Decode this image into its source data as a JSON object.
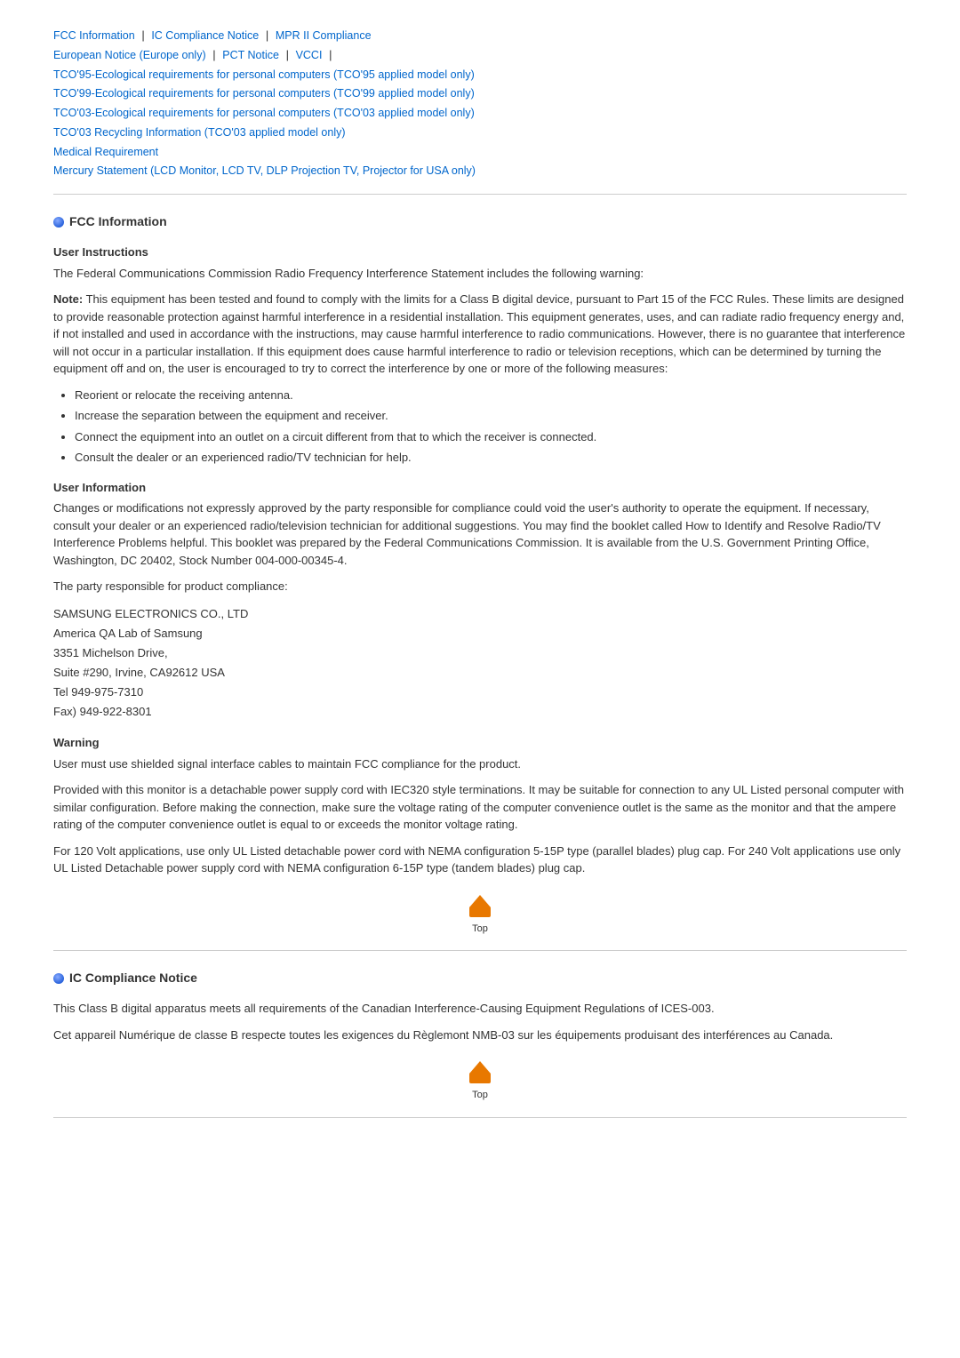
{
  "nav": {
    "line1": [
      {
        "text": "FCC Information",
        "sep": " | "
      },
      {
        "text": "IC Compliance Notice",
        "sep": " | "
      },
      {
        "text": "MPR II Compliance",
        "sep": ""
      }
    ],
    "line2": [
      {
        "text": "European Notice (Europe only)",
        "sep": " | "
      },
      {
        "text": "PCT Notice",
        "sep": " | "
      },
      {
        "text": "VCCI",
        "sep": " | "
      }
    ],
    "line3": {
      "text": "TCO'95-Ecological requirements for personal computers (TCO'95 applied model only)"
    },
    "line4": {
      "text": "TCO'99-Ecological requirements for personal computers (TCO'99 applied model only)"
    },
    "line5": {
      "text": "TCO'03-Ecological requirements for personal computers (TCO'03 applied model only)"
    },
    "line6": {
      "text": "TCO'03 Recycling Information (TCO'03 applied model only)"
    },
    "line7": {
      "text": "Medical Requirement"
    },
    "line8": {
      "text": "Mercury Statement (LCD Monitor, LCD TV, DLP Projection TV, Projector for USA only)"
    }
  },
  "fcc_section": {
    "heading": "FCC Information",
    "user_instructions": {
      "label": "User Instructions",
      "intro": "The Federal Communications Commission Radio Frequency Interference Statement includes the following warning:",
      "note_bold": "Note:",
      "note_text": " This equipment has been tested and found to comply with the limits for a Class B digital device, pursuant to Part 15 of the FCC Rules. These limits are designed to provide reasonable protection against harmful interference in a residential installation. This equipment generates, uses, and can radiate radio frequency energy and, if not installed and used in accordance with the instructions, may cause harmful interference to radio communications. However, there is no guarantee that interference will not occur in a particular installation. If this equipment does cause harmful interference to radio or television receptions, which can be determined by turning the equipment off and on, the user is encouraged to try to correct the interference by one or more of the following measures:",
      "bullets": [
        "Reorient or relocate the receiving antenna.",
        "Increase the separation between the equipment and receiver.",
        "Connect the equipment into an outlet on a circuit different from that to which the receiver is connected.",
        "Consult the dealer or an experienced radio/TV technician for help."
      ]
    },
    "user_information": {
      "label": "User Information",
      "para1": "Changes or modifications not expressly approved by the party responsible for compliance could void the user's authority to operate the equipment. If necessary, consult your dealer or an experienced radio/television technician for additional suggestions. You may find the booklet called How to Identify and Resolve Radio/TV Interference Problems helpful. This booklet was prepared by the Federal Communications Commission. It is available from the U.S. Government Printing Office, Washington, DC 20402, Stock Number 004-000-00345-4.",
      "para2": "The party responsible for product compliance:",
      "address": "SAMSUNG ELECTRONICS CO., LTD\nAmerica QA Lab of Samsung\n3351 Michelson Drive,\nSuite #290, Irvine, CA92612 USA\nTel 949-975-7310\nFax) 949-922-8301"
    },
    "warning": {
      "label": "Warning",
      "para1": "User must use shielded signal interface cables to maintain FCC compliance for the product.",
      "para2": "Provided with this monitor is a detachable power supply cord with IEC320 style terminations. It may be suitable for connection to any UL Listed personal computer with similar configuration. Before making the connection, make sure the voltage rating of the computer convenience outlet is the same as the monitor and that the ampere rating of the computer convenience outlet is equal to or exceeds the monitor voltage rating.",
      "para3": "For 120 Volt applications, use only UL Listed detachable power cord with NEMA configuration 5-15P type (parallel blades) plug cap. For 240 Volt applications use only UL Listed Detachable power supply cord with NEMA configuration 6-15P type (tandem blades) plug cap."
    },
    "top_label": "Top"
  },
  "ic_section": {
    "heading": "IC Compliance Notice",
    "para1": "This Class B digital apparatus meets all requirements of the Canadian Interference-Causing Equipment Regulations of ICES-003.",
    "para2": "Cet appareil Numérique de classe B respecte toutes les exigences du Règlemont NMB-03 sur les équipements produisant des interférences au Canada.",
    "top_label": "Top"
  }
}
